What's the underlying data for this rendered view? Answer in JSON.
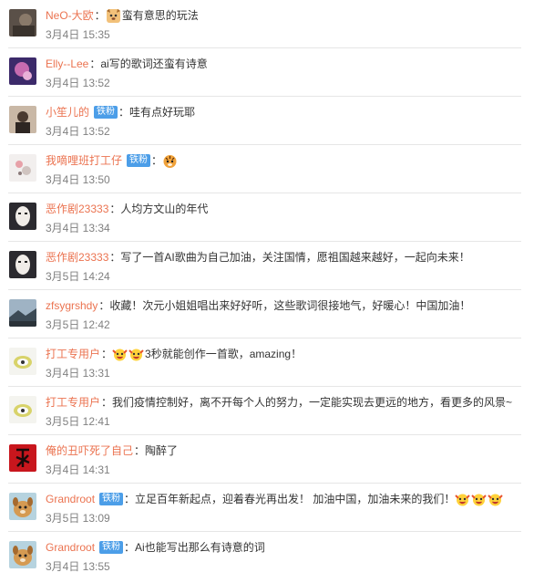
{
  "comments": [
    {
      "user": "NeO-大欧",
      "badge": "",
      "prefix_emojis": [
        "dog-emoji"
      ],
      "text": "蛮有意思的玩法",
      "suffix_emojis": [],
      "time": "3月4日 15:35",
      "avatar": "avatar-dark-photo"
    },
    {
      "user": "Elly--Lee",
      "badge": "",
      "prefix_emojis": [],
      "text": "ai写的歌词还蛮有诗意",
      "suffix_emojis": [],
      "time": "3月4日 13:52",
      "avatar": "avatar-purple-photo"
    },
    {
      "user": "小笙儿的",
      "badge": "铁粉",
      "prefix_emojis": [],
      "text": "哇有点好玩耶",
      "suffix_emojis": [],
      "time": "3月4日 13:52",
      "avatar": "avatar-person-photo"
    },
    {
      "user": "我嘀哩班打工仔",
      "badge": "铁粉",
      "prefix_emojis": [
        "tiger-emoji"
      ],
      "text": "",
      "suffix_emojis": [],
      "time": "3月4日 13:50",
      "avatar": "avatar-white-photo"
    },
    {
      "user": "恶作剧23333",
      "badge": "",
      "prefix_emojis": [],
      "text": "人均方文山的年代",
      "suffix_emojis": [],
      "time": "3月4日 13:34",
      "avatar": "avatar-mask-photo"
    },
    {
      "user": "恶作剧23333",
      "badge": "",
      "prefix_emojis": [],
      "text": "写了一首AI歌曲为自己加油，关注国情，愿祖国越来越好，一起向未来！",
      "suffix_emojis": [],
      "time": "3月5日 14:24",
      "avatar": "avatar-mask-photo"
    },
    {
      "user": "zfsygrshdy",
      "badge": "",
      "prefix_emojis": [],
      "text": "收藏！次元小姐姐唱出来好好听，这些歌词很接地气，好暖心！中国加油！",
      "suffix_emojis": [],
      "time": "3月5日 12:42",
      "avatar": "avatar-landscape-photo"
    },
    {
      "user": "打工专用户",
      "badge": "",
      "prefix_emojis": [
        "cheer-emoji",
        "cheer-emoji"
      ],
      "text": "3秒就能创作一首歌，amazing！",
      "suffix_emojis": [],
      "time": "3月4日 13:31",
      "avatar": "avatar-sticker-photo"
    },
    {
      "user": "打工专用户",
      "badge": "",
      "prefix_emojis": [],
      "text": "我们疫情控制好，离不开每个人的努力，一定能实现去更远的地方，看更多的风景~",
      "suffix_emojis": [],
      "time": "3月5日 12:41",
      "avatar": "avatar-sticker-photo"
    },
    {
      "user": "俺的丑吓死了自己",
      "badge": "",
      "prefix_emojis": [],
      "text": "陶醉了",
      "suffix_emojis": [],
      "time": "3月4日 14:31",
      "avatar": "avatar-red-calligraphy"
    },
    {
      "user": "Grandroot",
      "badge": "铁粉",
      "prefix_emojis": [],
      "text": "立足百年新起点，迎着春光再出发！ 加油中国，加油未来的我们！",
      "suffix_emojis": [
        "cheer-emoji",
        "cheer-emoji",
        "cheer-emoji"
      ],
      "time": "3月5日 13:09",
      "avatar": "avatar-dog-photo"
    },
    {
      "user": "Grandroot",
      "badge": "铁粉",
      "prefix_emojis": [],
      "text": "Ai也能写出那么有诗意的词",
      "suffix_emojis": [],
      "time": "3月4日 13:55",
      "avatar": "avatar-dog-photo"
    }
  ],
  "colon": "："
}
